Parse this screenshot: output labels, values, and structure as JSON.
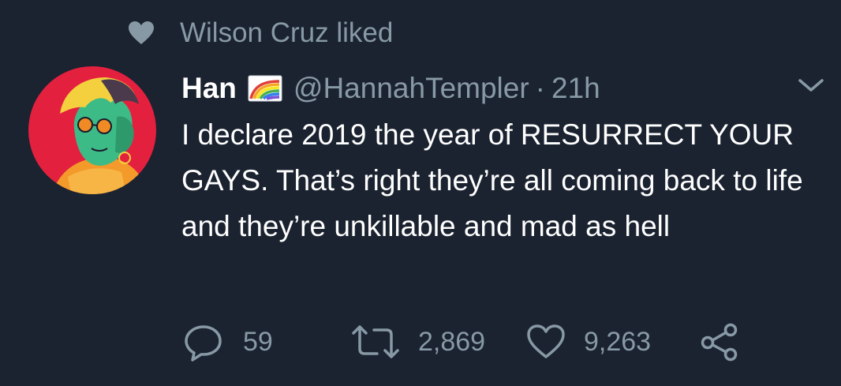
{
  "liked_by": {
    "text": "Wilson Cruz liked",
    "icon": "heart-icon"
  },
  "tweet": {
    "display_name": "Han",
    "flag_icon": "rainbow-flag-icon",
    "handle": "@HannahTempler",
    "separator": "·",
    "time": "21h",
    "text": "I declare 2019 the year of RESURRECT YOUR GAYS. That’s right they’re all coming back to life and they’re unkillable and mad as hell",
    "menu_icon": "chevron-down-icon"
  },
  "actions": {
    "reply_count": "59",
    "retweet_count": "2,869",
    "like_count": "9,263"
  },
  "colors": {
    "background": "#1b2330",
    "muted_text": "#8899a6",
    "primary_text": "#ffffff",
    "avatar_bg": "#e4203f"
  }
}
